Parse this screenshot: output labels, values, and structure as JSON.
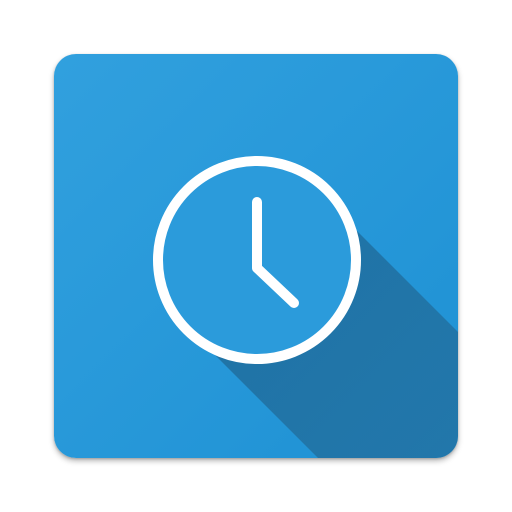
{
  "icon": {
    "name": "clock-icon",
    "colors": {
      "background_light": "#2f9fdd",
      "background_dark": "#1f93d6",
      "long_shadow": "#1f6896",
      "foreground": "#ffffff"
    },
    "clock_time": "5:00"
  }
}
